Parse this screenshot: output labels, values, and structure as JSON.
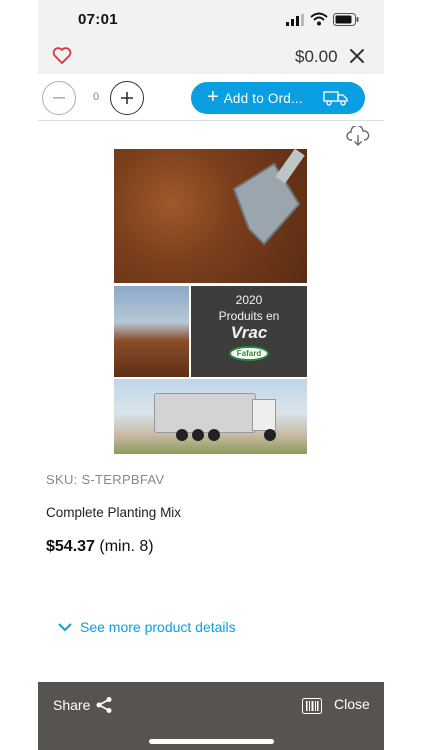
{
  "status_bar": {
    "time": "07:01"
  },
  "header": {
    "cart_total": "$0.00"
  },
  "quantity": {
    "value": "0"
  },
  "add_button": {
    "label": "Add to Ord..."
  },
  "product_image": {
    "year": "2020",
    "line1": "Produits en",
    "line2": "Vrac",
    "brand": "Fafard"
  },
  "product": {
    "sku": "SKU: S-TERPBFAV",
    "name": "Complete Planting Mix",
    "price": "$54.37",
    "min": "(min. 8)"
  },
  "details_link": {
    "label": "See more product details"
  },
  "bottom_bar": {
    "share_label": "Share",
    "close_label": "Close"
  },
  "colors": {
    "accent": "#0a9fe2",
    "bottom_bar": "#57534f",
    "heart": "#d9363e"
  },
  "icons": [
    "signal-icon",
    "wifi-icon",
    "battery-icon",
    "heart-icon",
    "close-icon",
    "minus-icon",
    "plus-icon",
    "truck-icon",
    "cloud-download-icon",
    "chevron-down-icon",
    "share-icon",
    "barcode-icon"
  ]
}
